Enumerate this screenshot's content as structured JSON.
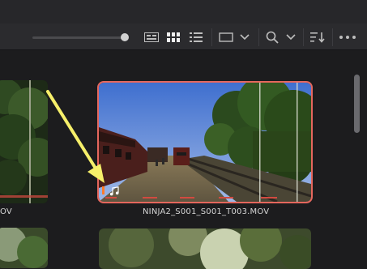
{
  "toolbar": {
    "icons": [
      "list-view-icon",
      "thumbnail-view-icon",
      "list-icon",
      "clip-frame-icon",
      "chevron-down-icon",
      "search-icon",
      "chevron-down-icon",
      "sort-icon",
      "more-options-icon"
    ],
    "zoom_slider_level": 1.0
  },
  "clips": [
    {
      "name": "",
      "partial_label": "OV"
    },
    {
      "name": "NINJA2_S001_S001_T003.MOV",
      "selected": true,
      "audio_icon": "music-note-icon"
    }
  ],
  "colors": {
    "accent": "#e5675d",
    "annotation_arrow": "#f6ef6a"
  }
}
